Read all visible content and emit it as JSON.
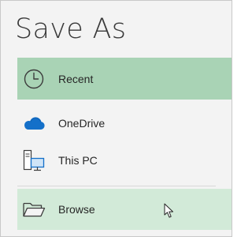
{
  "window": {
    "title": "Save As"
  },
  "locations": [
    {
      "label": "Recent",
      "icon": "clock-icon",
      "selected": true
    },
    {
      "label": "OneDrive",
      "icon": "cloud-icon",
      "selected": false
    },
    {
      "label": "This PC",
      "icon": "computer-icon",
      "selected": false
    },
    {
      "label": "Browse",
      "icon": "folder-icon",
      "hovered": true
    }
  ],
  "colors": {
    "selected_bg": "#a9d3b5",
    "hover_bg": "#d2ead8",
    "onedrive_blue": "#1470c9",
    "text": "#262626"
  }
}
